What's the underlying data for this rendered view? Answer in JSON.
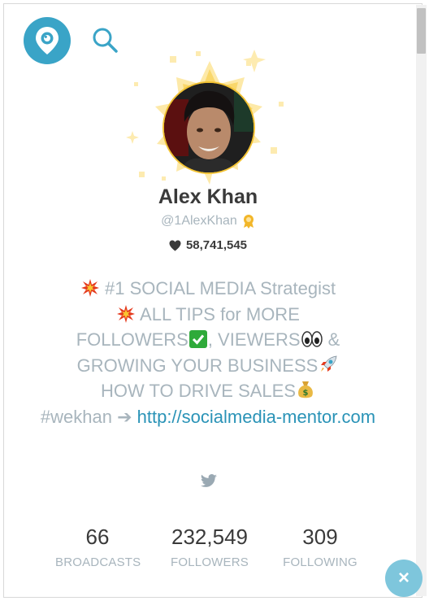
{
  "app": {
    "brand_color": "#3aa4c7",
    "logo_icon": "periscope-pin-icon",
    "search_icon": "search-icon"
  },
  "profile": {
    "name": "Alex Khan",
    "handle": "@1AlexKhan",
    "verified_icon": "award-badge-icon",
    "hearts_icon": "heart-icon",
    "hearts": "58,741,545",
    "bio": {
      "line1": "#1 SOCIAL MEDIA Strategist",
      "line2": "ALL TIPS for MORE",
      "line3_a": "FOLLOWERS",
      "line3_b": ", VIEWERS",
      "line3_c": " &",
      "line4": "GROWING YOUR BUSINESS",
      "line5": "HOW TO DRIVE SALES",
      "line6_tag": "#wekhan ➔ ",
      "link": "http://socialmedia-mentor.com"
    },
    "social_icon": "twitter-icon"
  },
  "stats": [
    {
      "value": "66",
      "label": "BROADCASTS"
    },
    {
      "value": "232,549",
      "label": "FOLLOWERS"
    },
    {
      "value": "309",
      "label": "FOLLOWING"
    }
  ],
  "close_icon": "close-icon",
  "close_glyph": "×"
}
